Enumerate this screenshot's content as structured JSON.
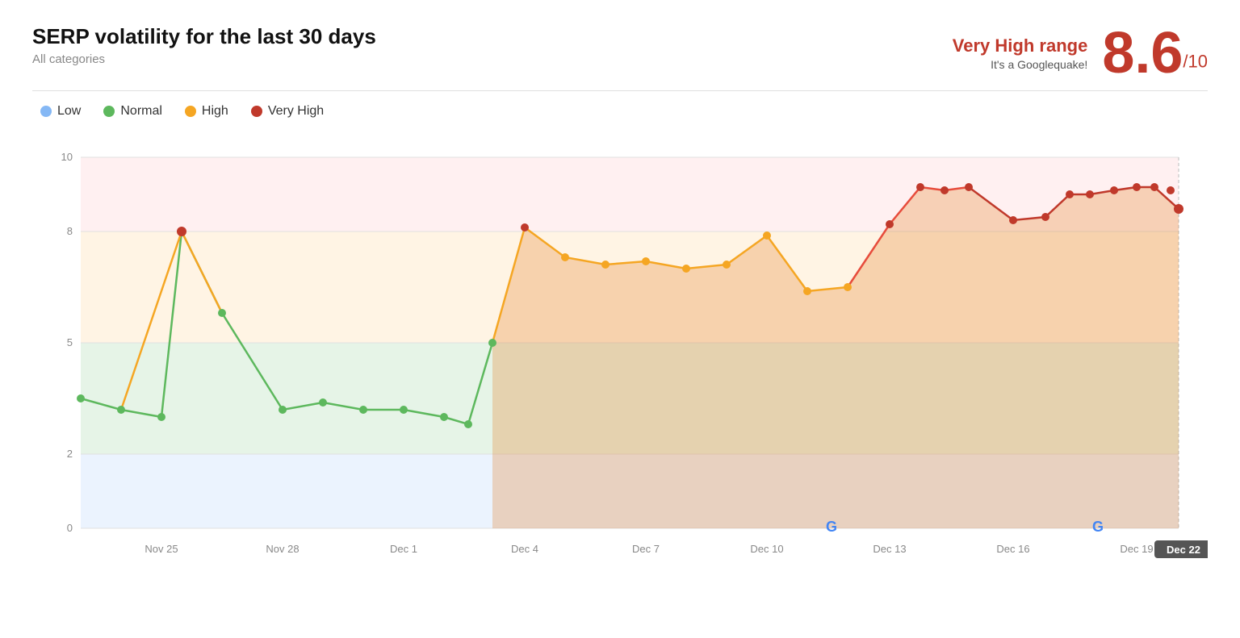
{
  "header": {
    "title": "SERP volatility for the last 30 days",
    "subtitle": "All categories",
    "score_range": "Very High range",
    "score_desc": "It's a Googlequake!",
    "score_value": "8.6",
    "score_denom": "/10"
  },
  "legend": {
    "items": [
      {
        "label": "Low",
        "color": "#85b8f5"
      },
      {
        "label": "Normal",
        "color": "#5db85d"
      },
      {
        "label": "High",
        "color": "#f5a623"
      },
      {
        "label": "Very High",
        "color": "#c0392b"
      }
    ]
  },
  "chart": {
    "x_labels": [
      "Nov 25",
      "Nov 28",
      "Dec 1",
      "Dec 4",
      "Dec 7",
      "Dec 10",
      "Dec 13",
      "Dec 16",
      "Dec 19",
      "Dec 22"
    ],
    "y_labels": [
      "0",
      "2",
      "5",
      "8",
      "10"
    ],
    "last_date_badge": "Dec 22",
    "zones": {
      "low_max": 2,
      "normal_max": 5,
      "high_max": 8,
      "very_high_max": 10
    }
  }
}
